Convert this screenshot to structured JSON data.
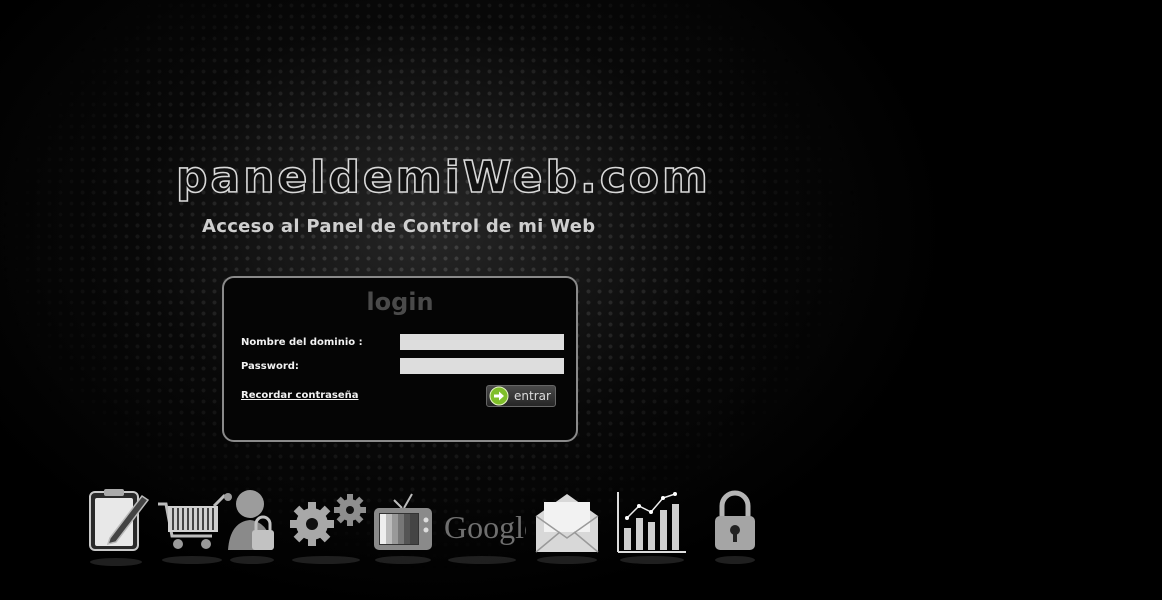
{
  "header": {
    "site_title": "paneldemiWeb.com",
    "subtitle": "Acceso al Panel de Control de mi Web"
  },
  "login": {
    "title": "login",
    "domain_label": "Nombre del dominio :",
    "domain_value": "",
    "password_label": "Password:",
    "password_value": "",
    "forgot_link": "Recordar contraseña",
    "enter_button": "entrar"
  },
  "icon_bar": {
    "items": [
      {
        "icon": "notepad-pencil-icon"
      },
      {
        "icon": "shopping-cart-icon"
      },
      {
        "icon": "user-lock-icon"
      },
      {
        "icon": "gears-icon"
      },
      {
        "icon": "television-icon"
      },
      {
        "icon": "google-icon",
        "text": "Google"
      },
      {
        "icon": "envelope-icon"
      },
      {
        "icon": "bar-chart-icon"
      },
      {
        "icon": "padlock-icon"
      }
    ]
  },
  "colors": {
    "background": "#000000",
    "title_outline": "#d8d8d8",
    "login_border": "#8a8a8a",
    "enter_arrow": "#7fbf2a"
  }
}
